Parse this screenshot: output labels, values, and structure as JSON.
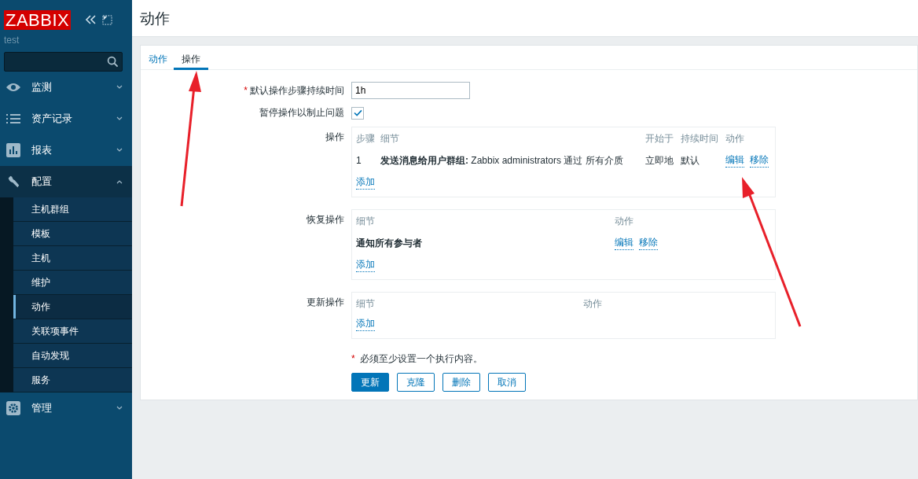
{
  "sidebar": {
    "logo": "ZABBIX",
    "user": "test",
    "menu": [
      {
        "label": "监测",
        "kind": "eye",
        "expanded": false
      },
      {
        "label": "资产记录",
        "kind": "list",
        "expanded": false
      },
      {
        "label": "报表",
        "kind": "chart",
        "expanded": false
      },
      {
        "label": "配置",
        "kind": "wrench",
        "expanded": true,
        "children": [
          {
            "label": "主机群组",
            "selected": false
          },
          {
            "label": "模板",
            "selected": false
          },
          {
            "label": "主机",
            "selected": false
          },
          {
            "label": "维护",
            "selected": false
          },
          {
            "label": "动作",
            "selected": true
          },
          {
            "label": "关联项事件",
            "selected": false
          },
          {
            "label": "自动发现",
            "selected": false
          },
          {
            "label": "服务",
            "selected": false
          }
        ]
      },
      {
        "label": "管理",
        "kind": "gear",
        "expanded": false
      }
    ]
  },
  "page_title": "动作",
  "tabs": [
    {
      "label": "动作",
      "selected": false
    },
    {
      "label": "操作",
      "selected": true
    }
  ],
  "form": {
    "duration": {
      "required_mark": "*",
      "label": "默认操作步骤持续时间",
      "value": "1h"
    },
    "pause": {
      "label": "暂停操作以制止问题",
      "checked": true
    },
    "sections": [
      {
        "label": "操作",
        "columns": [
          "步骤",
          "细节",
          "开始于",
          "持续时间",
          "动作"
        ],
        "rows": [
          {
            "cells": [
              "1",
              "**发送消息给用户群组:** Zabbix administrators 通过 所有介质",
              "立即地",
              "默认"
            ],
            "actions": [
              "编辑",
              "移除"
            ]
          }
        ],
        "add": "添加"
      },
      {
        "label": "恢复操作",
        "columns": [
          "细节",
          "动作"
        ],
        "rows": [
          {
            "cells": [
              "**通知所有参与者**"
            ],
            "actions": [
              "编辑",
              "移除"
            ]
          }
        ],
        "add": "添加"
      },
      {
        "label": "更新操作",
        "columns": [
          "细节",
          "动作"
        ],
        "add": "添加"
      }
    ],
    "note": {
      "required_mark": "*",
      "text": "必须至少设置一个执行内容。"
    },
    "buttons": [
      {
        "label": "更新",
        "primary": true
      },
      {
        "label": "克隆",
        "primary": false
      },
      {
        "label": "删除",
        "primary": false
      },
      {
        "label": "取消",
        "primary": false
      }
    ]
  }
}
